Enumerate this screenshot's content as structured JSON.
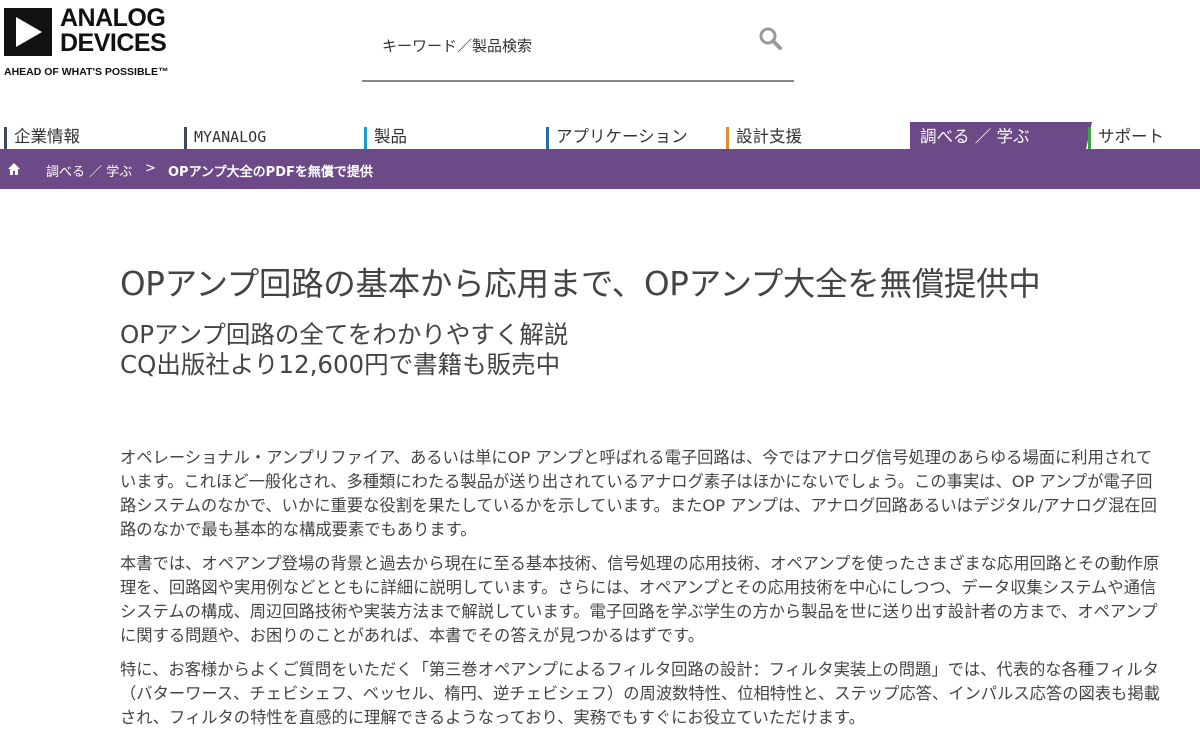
{
  "brand": {
    "logo_line1": "ANALOG",
    "logo_line2": "DEVICES",
    "tagline": "AHEAD OF WHAT'S POSSIBLE™"
  },
  "search": {
    "placeholder": "キーワード／製品検索"
  },
  "nav": [
    {
      "label": "企業情報",
      "accent": "#3d4a5a"
    },
    {
      "label": "MYANALOG",
      "accent": "#3d4a5a"
    },
    {
      "label": "製品",
      "accent": "#1a9fc4"
    },
    {
      "label": "アプリケーション",
      "accent": "#2a6aa8"
    },
    {
      "label": "設計支援",
      "accent": "#e08b2c"
    },
    {
      "label": "調べる ／ 学ぶ",
      "accent": "#6c4a87",
      "active": true
    },
    {
      "label": "サポート",
      "accent": "#3aa544"
    }
  ],
  "breadcrumb": {
    "item1": "調べる ／ 学ぶ",
    "separator": ">",
    "current": "OPアンプ大全のPDFを無償で提供"
  },
  "main": {
    "title": "OPアンプ回路の基本から応用まで、OPアンプ大全を無償提供中",
    "subtitle1": "OPアンプ回路の全てをわかりやすく解説",
    "subtitle2": "CQ出版社より12,600円で書籍も販売中",
    "paragraphs": [
      "オペレーショナル・アンプリファイア、あるいは単にOP アンプと呼ばれる電子回路は、今ではアナログ信号処理のあらゆる場面に利用されています。これほど一般化され、多種類にわたる製品が送り出されているアナログ素子はほかにないでしょう。この事実は、OP アンプが電子回路システムのなかで、いかに重要な役割を果たしているかを示しています。またOP アンプは、アナログ回路あるいはデジタル/アナログ混在回路のなかで最も基本的な構成要素でもあります。",
      "本書では、オペアンプ登場の背景と過去から現在に至る基本技術、信号処理の応用技術、オペアンプを使ったさまざまな応用回路とその動作原理を、回路図や実用例などとともに詳細に説明しています。さらには、オペアンプとその応用技術を中心にしつつ、データ収集システムや通信システムの構成、周辺回路技術や実装方法まで解説しています。電子回路を学ぶ学生の方から製品を世に送り出す設計者の方まで、オペアンプに関する問題や、お困りのことがあれば、本書でその答えが見つかるはずです。",
      "特に、お客様からよくご質問をいただく「第三巻オペアンプによるフィルタ回路の設計：フィルタ実装上の問題」では、代表的な各種フィルタ（バターワース、チェビシェフ、ベッセル、楕円、逆チェビシェフ）の周波数特性、位相特性と、ステップ応答、インパルス応答の図表も掲載され、フィルタの特性を直感的に理解できるようなっており、実務でもすぐにお役立ていただけます。"
    ]
  }
}
